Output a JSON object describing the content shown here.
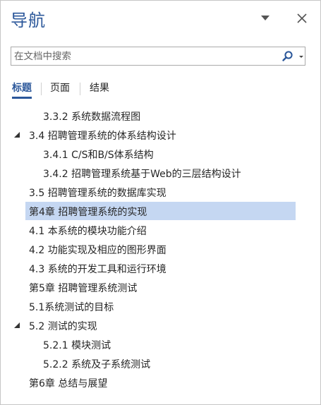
{
  "pane": {
    "title": "导航",
    "accent": "#2b579a",
    "highlight": "#c5d7f2",
    "menu_icon": "chevron-down-icon",
    "close_icon": "close-icon"
  },
  "search": {
    "placeholder": "在文档中搜索",
    "value": "",
    "icon": "search-icon"
  },
  "tabs": [
    {
      "label": "标题",
      "active": true
    },
    {
      "label": "页面",
      "active": false
    },
    {
      "label": "结果",
      "active": false
    }
  ],
  "headings": [
    {
      "text": "3.3.2 系统数据流程图",
      "level": 3,
      "expanded": false,
      "selected": false
    },
    {
      "text": "3.4 招聘管理系统的体系结构设计",
      "level": 2,
      "expanded": true,
      "selected": false
    },
    {
      "text": "3.4.1 C/S和B/S体系结构",
      "level": 3,
      "expanded": false,
      "selected": false
    },
    {
      "text": "3.4.2 招聘管理系统基于Web的三层结构设计",
      "level": 3,
      "expanded": false,
      "selected": false
    },
    {
      "text": "3.5 招聘管理系统的数据库实现",
      "level": 2,
      "expanded": false,
      "selected": false
    },
    {
      "text": "第4章 招聘管理系统的实现",
      "level": 1,
      "expanded": false,
      "selected": true
    },
    {
      "text": "4.1 本系统的模块功能介绍",
      "level": 2,
      "expanded": false,
      "selected": false
    },
    {
      "text": "4.2 功能实现及相应的图形界面",
      "level": 2,
      "expanded": false,
      "selected": false
    },
    {
      "text": "4.3 系统的开发工具和运行环境",
      "level": 2,
      "expanded": false,
      "selected": false
    },
    {
      "text": "第5章 招聘管理系统测试",
      "level": 1,
      "expanded": false,
      "selected": false
    },
    {
      "text": "5.1系统测试的目标",
      "level": 2,
      "expanded": false,
      "selected": false
    },
    {
      "text": "5.2 测试的实现",
      "level": 2,
      "expanded": true,
      "selected": false
    },
    {
      "text": "5.2.1 模块测试",
      "level": 3,
      "expanded": false,
      "selected": false
    },
    {
      "text": "5.2.2 系统及子系统测试",
      "level": 3,
      "expanded": false,
      "selected": false
    },
    {
      "text": "第6章 总结与展望",
      "level": 1,
      "expanded": false,
      "selected": false
    }
  ]
}
